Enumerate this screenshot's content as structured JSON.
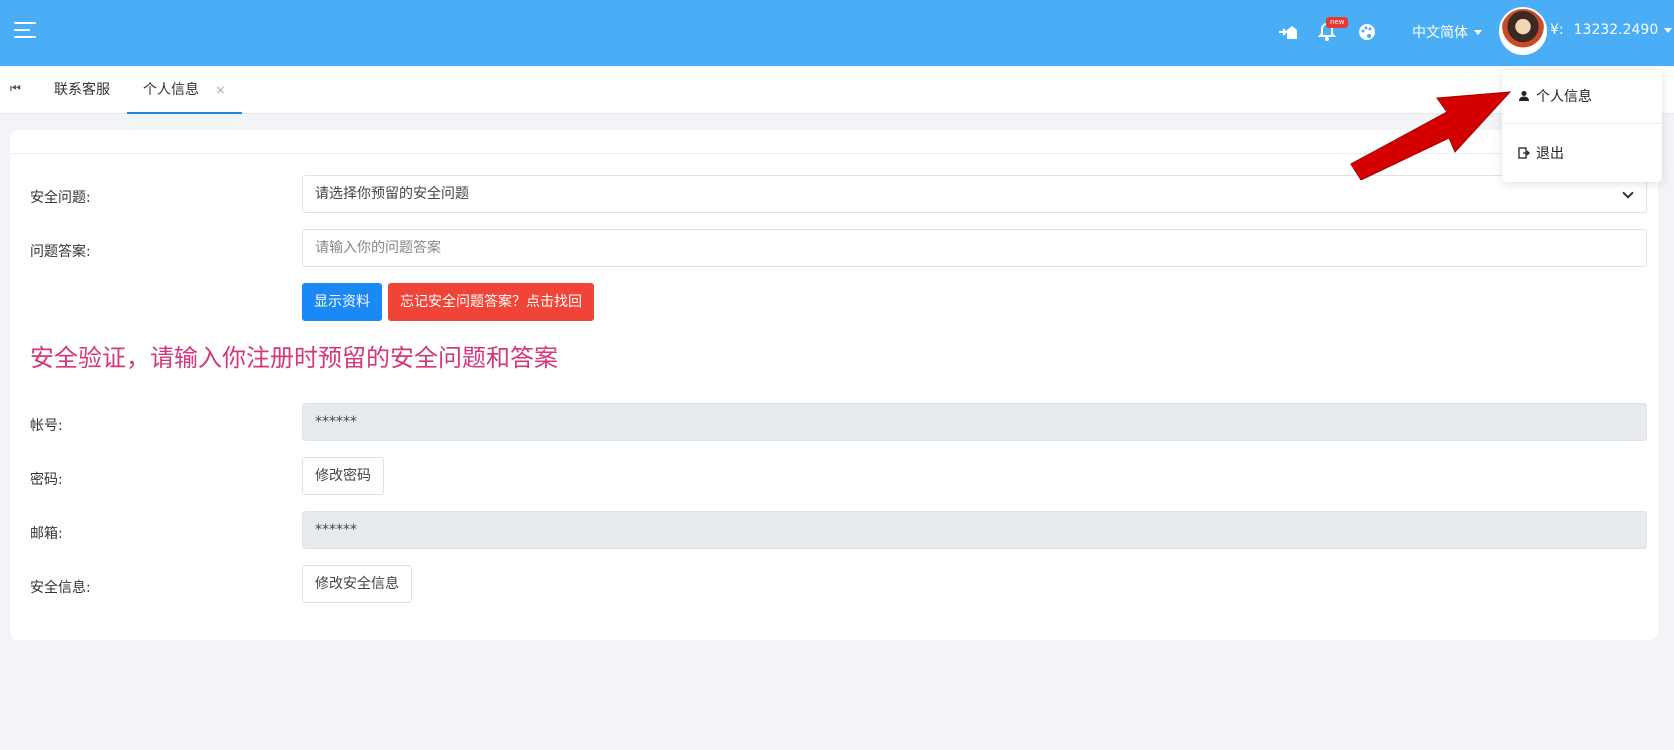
{
  "navbar": {
    "menu_icon": "hamburger-icon",
    "icons": [
      "login-icon",
      "bell-icon",
      "palette-icon"
    ],
    "badge": "new",
    "language": "中文简体",
    "currency_symbol": "¥:",
    "balance": "13232.2490"
  },
  "tabs": {
    "first_icon": "first-page-icon",
    "items": [
      {
        "label": "联系客服"
      },
      {
        "label": "个人信息",
        "close": "×"
      }
    ]
  },
  "form": {
    "security_question_label": "安全问题:",
    "security_question_value": "请选择你预留的安全问题",
    "answer_label": "问题答案:",
    "answer_placeholder": "请输入你的问题答案",
    "show_button": "显示资料",
    "forgot_button": "忘记安全问题答案？点击找回",
    "warning": "安全验证，请输入你注册时预留的安全问题和答案",
    "account_label": "帐号:",
    "account_value": "******",
    "password_label": "密码:",
    "password_button": "修改密码",
    "email_label": "邮箱:",
    "email_value": "******",
    "security_info_label": "安全信息:",
    "security_info_button": "修改安全信息"
  },
  "dropdown": {
    "items": [
      {
        "label": "个人信息",
        "icon": "user-icon"
      },
      {
        "label": "退出",
        "icon": "logout-icon"
      }
    ]
  },
  "colors": {
    "navbar": "#4aaef7",
    "primary": "#1a88f5",
    "danger": "#f04438",
    "warning_text": "#d4377b",
    "annotation_arrow": "#d40000"
  }
}
